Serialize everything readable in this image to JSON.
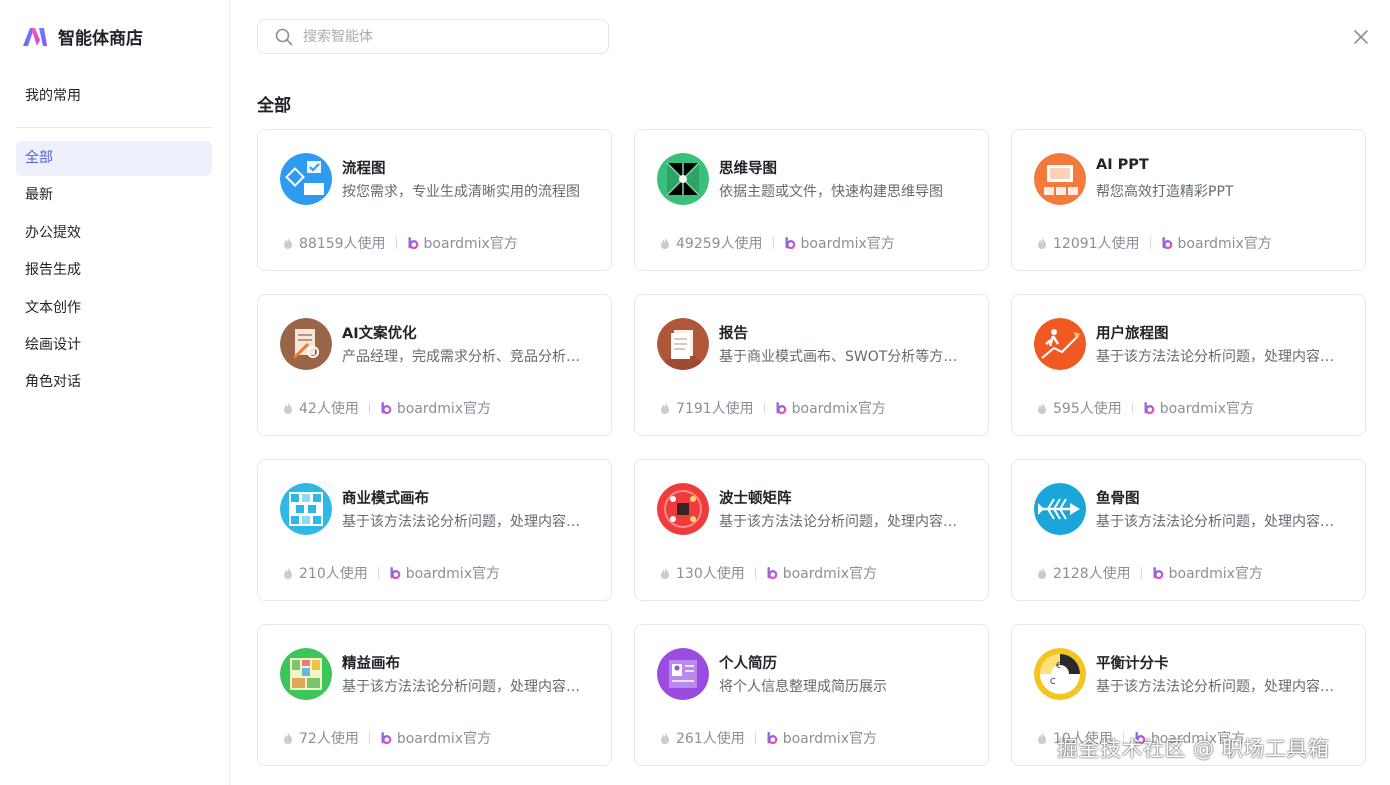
{
  "app": {
    "title": "智能体商店"
  },
  "sidebar": {
    "favorites_label": "我的常用",
    "items": [
      {
        "label": "全部",
        "active": true
      },
      {
        "label": "最新"
      },
      {
        "label": "办公提效"
      },
      {
        "label": "报告生成"
      },
      {
        "label": "文本创作"
      },
      {
        "label": "绘画设计"
      },
      {
        "label": "角色对话"
      }
    ]
  },
  "search": {
    "placeholder": "搜索智能体",
    "value": ""
  },
  "section": {
    "title": "全部"
  },
  "accent_color": "#4f5fd8",
  "cards": [
    {
      "title": "流程图",
      "desc": "按您需求，专业生成清晰实用的流程图",
      "uses": "88159人使用",
      "author": "boardmix官方",
      "icon": "flowchart-icon",
      "color": "#2f9bf0"
    },
    {
      "title": "思维导图",
      "desc": "依据主题或文件，快速构建思维导图",
      "uses": "49259人使用",
      "author": "boardmix官方",
      "icon": "mindmap-icon",
      "color": "#39c07a"
    },
    {
      "title": "AI PPT",
      "desc": "帮您高效打造精彩PPT",
      "uses": "12091人使用",
      "author": "boardmix官方",
      "icon": "ppt-icon",
      "color": "#f47a3b"
    },
    {
      "title": "AI文案优化",
      "desc": "产品经理，完成需求分析、竞品分析等工作",
      "uses": "42人使用",
      "author": "boardmix官方",
      "icon": "copywriting-icon",
      "color": "#9a6448"
    },
    {
      "title": "报告",
      "desc": "基于商业模式画布、SWOT分析等方法撰写报告",
      "uses": "7191人使用",
      "author": "boardmix官方",
      "icon": "report-icon",
      "color": "#b0573a"
    },
    {
      "title": "用户旅程图",
      "desc": "基于该方法法论分析问题，处理内容并输出",
      "uses": "595人使用",
      "author": "boardmix官方",
      "icon": "journey-icon",
      "color": "#f05a22"
    },
    {
      "title": "商业模式画布",
      "desc": "基于该方法法论分析问题，处理内容并输出",
      "uses": "210人使用",
      "author": "boardmix官方",
      "icon": "canvas-icon",
      "color": "#2fb7e6"
    },
    {
      "title": "波士顿矩阵",
      "desc": "基于该方法法论分析问题，处理内容并输出",
      "uses": "130人使用",
      "author": "boardmix官方",
      "icon": "matrix-icon",
      "color": "#ef3b3b"
    },
    {
      "title": "鱼骨图",
      "desc": "基于该方法法论分析问题，处理内容并输出",
      "uses": "2128人使用",
      "author": "boardmix官方",
      "icon": "fishbone-icon",
      "color": "#1aa6d9"
    },
    {
      "title": "精益画布",
      "desc": "基于该方法法论分析问题，处理内容并输出",
      "uses": "72人使用",
      "author": "boardmix官方",
      "icon": "lean-canvas-icon",
      "color": "#3cc65a"
    },
    {
      "title": "个人简历",
      "desc": "将个人信息整理成简历展示",
      "uses": "261人使用",
      "author": "boardmix官方",
      "icon": "resume-icon",
      "color": "#9b4be0"
    },
    {
      "title": "平衡计分卡",
      "desc": "基于该方法法论分析问题，处理内容并输出",
      "uses": "10人使用",
      "author": "boardmix官方",
      "icon": "scorecard-icon",
      "color": "#f3c51d"
    }
  ],
  "watermark": "掘金技术社区 @ 职场工具箱"
}
